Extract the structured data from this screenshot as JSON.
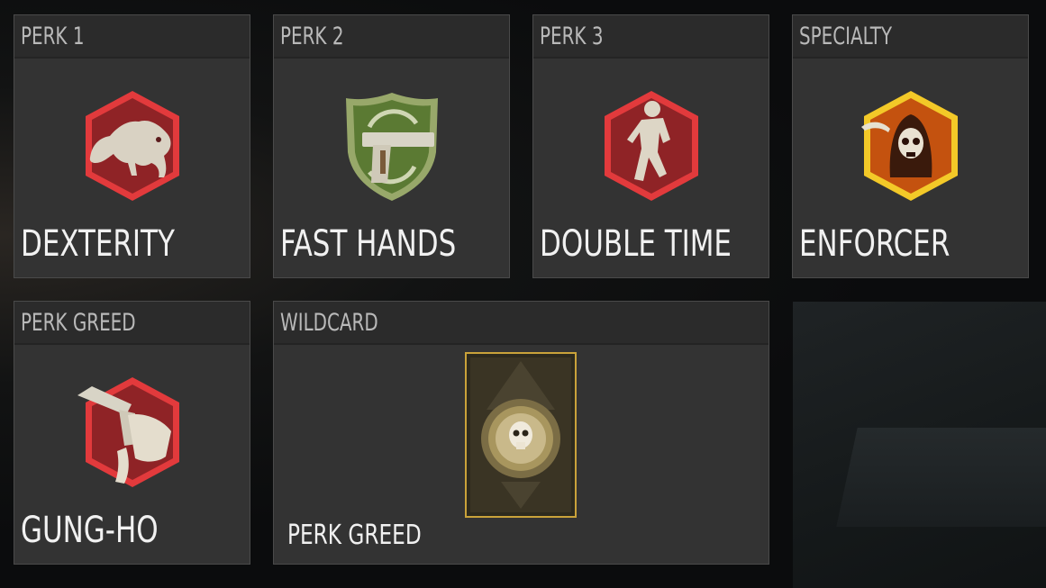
{
  "loadout": {
    "perks": [
      {
        "slot": "PERK 1",
        "name": "DEXTERITY",
        "icon": "cougar-icon",
        "badge_color": "#a32a2c"
      },
      {
        "slot": "PERK 2",
        "name": "FAST HANDS",
        "icon": "pistol-reload-icon",
        "badge_color": "#5e7d36"
      },
      {
        "slot": "PERK 3",
        "name": "DOUBLE TIME",
        "icon": "running-soldier-icon",
        "badge_color": "#a32a2c"
      },
      {
        "slot": "SPECIALTY",
        "name": "ENFORCER",
        "icon": "skull-reaper-icon",
        "badge_color": "#e8a417"
      },
      {
        "slot": "PERK GREED",
        "name": "GUNG-HO",
        "icon": "pistol-hand-icon",
        "badge_color": "#a32a2c"
      }
    ],
    "wildcard": {
      "slot": "WILDCARD",
      "name": "PERK GREED",
      "icon": "skull-ace-card-icon"
    }
  }
}
